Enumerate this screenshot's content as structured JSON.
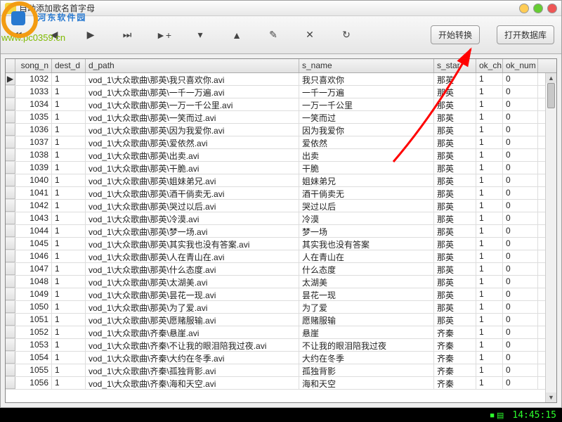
{
  "watermark": {
    "brand": "河东软件园",
    "url": "www.pc0359.cn"
  },
  "titlebar": {
    "title": "自动添加歌名首字母"
  },
  "toolbar": {
    "first": "⏮",
    "prev": "◀",
    "next": "▶",
    "last": "⏭",
    "add": "►+",
    "del": "▾",
    "up": "▲",
    "edit": "✎",
    "cancel": "✕",
    "redo": "↻",
    "convert_label": "开始转换",
    "open_db_label": "打开数据库"
  },
  "columns": {
    "indicator": "",
    "song_n": "song_n",
    "dest_d": "dest_d",
    "d_path": "d_path",
    "s_name": "s_name",
    "s_star": "s_star",
    "ok_ch": "ok_ch",
    "ok_num": "ok_num"
  },
  "rows": [
    {
      "song_n": "1032",
      "dest_d": "1",
      "d_path": "vod_1\\大众歌曲\\那英\\我只喜欢你.avi",
      "s_name": "我只喜欢你",
      "s_star": "那英",
      "ok_ch": "1",
      "ok_num": "0",
      "sel": true
    },
    {
      "song_n": "1033",
      "dest_d": "1",
      "d_path": "vod_1\\大众歌曲\\那英\\一千一万遍.avi",
      "s_name": "一千一万遍",
      "s_star": "那英",
      "ok_ch": "1",
      "ok_num": "0"
    },
    {
      "song_n": "1034",
      "dest_d": "1",
      "d_path": "vod_1\\大众歌曲\\那英\\一万一千公里.avi",
      "s_name": "一万一千公里",
      "s_star": "那英",
      "ok_ch": "1",
      "ok_num": "0"
    },
    {
      "song_n": "1035",
      "dest_d": "1",
      "d_path": "vod_1\\大众歌曲\\那英\\一笑而过.avi",
      "s_name": "一笑而过",
      "s_star": "那英",
      "ok_ch": "1",
      "ok_num": "0"
    },
    {
      "song_n": "1036",
      "dest_d": "1",
      "d_path": "vod_1\\大众歌曲\\那英\\因为我爱你.avi",
      "s_name": "因为我爱你",
      "s_star": "那英",
      "ok_ch": "1",
      "ok_num": "0"
    },
    {
      "song_n": "1037",
      "dest_d": "1",
      "d_path": "vod_1\\大众歌曲\\那英\\爱依然.avi",
      "s_name": "爱依然",
      "s_star": "那英",
      "ok_ch": "1",
      "ok_num": "0"
    },
    {
      "song_n": "1038",
      "dest_d": "1",
      "d_path": "vod_1\\大众歌曲\\那英\\出卖.avi",
      "s_name": "出卖",
      "s_star": "那英",
      "ok_ch": "1",
      "ok_num": "0"
    },
    {
      "song_n": "1039",
      "dest_d": "1",
      "d_path": "vod_1\\大众歌曲\\那英\\干脆.avi",
      "s_name": "干脆",
      "s_star": "那英",
      "ok_ch": "1",
      "ok_num": "0"
    },
    {
      "song_n": "1040",
      "dest_d": "1",
      "d_path": "vod_1\\大众歌曲\\那英\\姐妹弟兄.avi",
      "s_name": "姐妹弟兄",
      "s_star": "那英",
      "ok_ch": "1",
      "ok_num": "0"
    },
    {
      "song_n": "1041",
      "dest_d": "1",
      "d_path": "vod_1\\大众歌曲\\那英\\酒干倘卖无.avi",
      "s_name": "酒干倘卖无",
      "s_star": "那英",
      "ok_ch": "1",
      "ok_num": "0"
    },
    {
      "song_n": "1042",
      "dest_d": "1",
      "d_path": "vod_1\\大众歌曲\\那英\\哭过以后.avi",
      "s_name": "哭过以后",
      "s_star": "那英",
      "ok_ch": "1",
      "ok_num": "0"
    },
    {
      "song_n": "1043",
      "dest_d": "1",
      "d_path": "vod_1\\大众歌曲\\那英\\冷漠.avi",
      "s_name": "冷漠",
      "s_star": "那英",
      "ok_ch": "1",
      "ok_num": "0"
    },
    {
      "song_n": "1044",
      "dest_d": "1",
      "d_path": "vod_1\\大众歌曲\\那英\\梦一场.avi",
      "s_name": "梦一场",
      "s_star": "那英",
      "ok_ch": "1",
      "ok_num": "0"
    },
    {
      "song_n": "1045",
      "dest_d": "1",
      "d_path": "vod_1\\大众歌曲\\那英\\其实我也没有答案.avi",
      "s_name": "其实我也没有答案",
      "s_star": "那英",
      "ok_ch": "1",
      "ok_num": "0"
    },
    {
      "song_n": "1046",
      "dest_d": "1",
      "d_path": "vod_1\\大众歌曲\\那英\\人在青山在.avi",
      "s_name": "人在青山在",
      "s_star": "那英",
      "ok_ch": "1",
      "ok_num": "0"
    },
    {
      "song_n": "1047",
      "dest_d": "1",
      "d_path": "vod_1\\大众歌曲\\那英\\什么态度.avi",
      "s_name": "什么态度",
      "s_star": "那英",
      "ok_ch": "1",
      "ok_num": "0"
    },
    {
      "song_n": "1048",
      "dest_d": "1",
      "d_path": "vod_1\\大众歌曲\\那英\\太湖美.avi",
      "s_name": "太湖美",
      "s_star": "那英",
      "ok_ch": "1",
      "ok_num": "0"
    },
    {
      "song_n": "1049",
      "dest_d": "1",
      "d_path": "vod_1\\大众歌曲\\那英\\昙花一现.avi",
      "s_name": "昙花一现",
      "s_star": "那英",
      "ok_ch": "1",
      "ok_num": "0"
    },
    {
      "song_n": "1050",
      "dest_d": "1",
      "d_path": "vod_1\\大众歌曲\\那英\\为了爱.avi",
      "s_name": "为了爱",
      "s_star": "那英",
      "ok_ch": "1",
      "ok_num": "0"
    },
    {
      "song_n": "1051",
      "dest_d": "1",
      "d_path": "vod_1\\大众歌曲\\那英\\愿赌服输.avi",
      "s_name": "愿赌服输",
      "s_star": "那英",
      "ok_ch": "1",
      "ok_num": "0"
    },
    {
      "song_n": "1052",
      "dest_d": "1",
      "d_path": "vod_1\\大众歌曲\\齐秦\\悬崖.avi",
      "s_name": "悬崖",
      "s_star": "齐秦",
      "ok_ch": "1",
      "ok_num": "0"
    },
    {
      "song_n": "1053",
      "dest_d": "1",
      "d_path": "vod_1\\大众歌曲\\齐秦\\不让我的眼泪陪我过夜.avi",
      "s_name": "不让我的眼泪陪我过夜",
      "s_star": "齐秦",
      "ok_ch": "1",
      "ok_num": "0"
    },
    {
      "song_n": "1054",
      "dest_d": "1",
      "d_path": "vod_1\\大众歌曲\\齐秦\\大约在冬季.avi",
      "s_name": "大约在冬季",
      "s_star": "齐秦",
      "ok_ch": "1",
      "ok_num": "0"
    },
    {
      "song_n": "1055",
      "dest_d": "1",
      "d_path": "vod_1\\大众歌曲\\齐秦\\孤独背影.avi",
      "s_name": "孤独背影",
      "s_star": "齐秦",
      "ok_ch": "1",
      "ok_num": "0"
    },
    {
      "song_n": "1056",
      "dest_d": "1",
      "d_path": "vod_1\\大众歌曲\\齐秦\\海和天空.avi",
      "s_name": "海和天空",
      "s_star": "齐秦",
      "ok_ch": "1",
      "ok_num": "0"
    }
  ],
  "taskbar": {
    "time": "14:45:15",
    "icons": "■ ▤"
  }
}
